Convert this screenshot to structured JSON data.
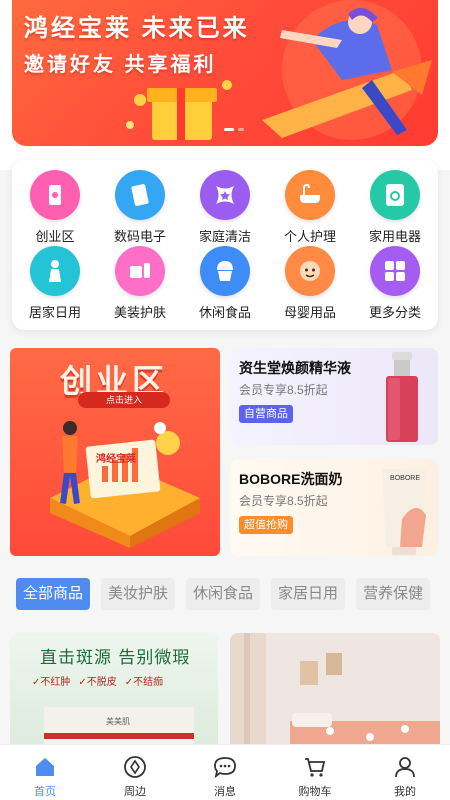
{
  "banner": {
    "title": "鸿经宝莱 未来已来",
    "subtitle": "邀请好友 共享福利"
  },
  "categories": [
    {
      "label": "创业区",
      "icon": "phone-icon",
      "color": "#ff5fb0"
    },
    {
      "label": "数码电子",
      "icon": "device-icon",
      "color": "#35a6f4"
    },
    {
      "label": "家庭清洁",
      "icon": "cleaning-icon",
      "color": "#9b5cf0"
    },
    {
      "label": "个人护理",
      "icon": "bathtub-icon",
      "color": "#ff8b3d"
    },
    {
      "label": "家用电器",
      "icon": "washer-icon",
      "color": "#26c9a6"
    },
    {
      "label": "居家日用",
      "icon": "person-icon",
      "color": "#25c3d6"
    },
    {
      "label": "美装护肤",
      "icon": "cosmetics-icon",
      "color": "#ff6fc8"
    },
    {
      "label": "休闲食品",
      "icon": "cupcake-icon",
      "color": "#3e8cf5"
    },
    {
      "label": "母婴用品",
      "icon": "baby-icon",
      "color": "#ff8a45"
    },
    {
      "label": "更多分类",
      "icon": "grid-icon",
      "color": "#a55cf0"
    }
  ],
  "promo": {
    "left": {
      "title": "创业区",
      "button": "点击进入",
      "brand": "鸿经宝莱"
    },
    "right": [
      {
        "title": "资生堂焕颜精华液",
        "subtitle": "会员专享8.5折起",
        "tag": "自营商品"
      },
      {
        "title": "BOBORE洗面奶",
        "subtitle": "会员专享8.5折起",
        "tag": "超值抢购",
        "brand": "BOBORE"
      }
    ]
  },
  "tabs": [
    {
      "label": "全部商品",
      "active": true
    },
    {
      "label": "美妆护肤",
      "active": false
    },
    {
      "label": "休闲食品",
      "active": false
    },
    {
      "label": "家居日用",
      "active": false
    },
    {
      "label": "营养保健",
      "active": false
    }
  ],
  "products": {
    "first": {
      "headline": "直击斑源 告别微瑕",
      "checks": [
        "✓不红肿",
        "✓不脱皮",
        "✓不结痂"
      ],
      "box_brand": "美美肌"
    }
  },
  "nav": [
    {
      "label": "首页",
      "icon": "home-icon",
      "active": true
    },
    {
      "label": "周边",
      "icon": "compass-icon",
      "active": false
    },
    {
      "label": "消息",
      "icon": "message-icon",
      "active": false
    },
    {
      "label": "购物车",
      "icon": "cart-icon",
      "active": false
    },
    {
      "label": "我的",
      "icon": "profile-icon",
      "active": false
    }
  ],
  "colors": {
    "accent": "#4f8cf0",
    "banner": "#ff4d3a"
  }
}
